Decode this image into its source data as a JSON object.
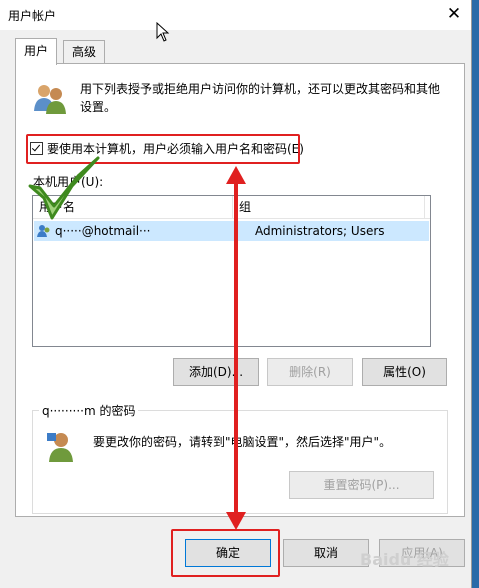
{
  "window": {
    "title": "用户帐户",
    "close_glyph": "✕"
  },
  "tabs": [
    {
      "label": "用户"
    },
    {
      "label": "高级"
    }
  ],
  "panel": {
    "description": "用下列表授予或拒绝用户访问你的计算机，还可以更改其密码和其他设置。",
    "require_login_label": "要使用本计算机，用户必须输入用户名和密码(E)",
    "local_users_label": "本机用户(U):",
    "columns": [
      "用户名",
      "组"
    ],
    "rows": [
      {
        "user": "q·····@hotmail···",
        "group": "Administrators; Users"
      }
    ],
    "buttons": {
      "add": "添加(D)...",
      "remove": "删除(R)",
      "properties": "属性(O)"
    },
    "password_group": {
      "title": "q·········m 的密码",
      "hint": "要更改你的密码，请转到\"电脑设置\"，然后选择\"用户\"。",
      "reset_button": "重置密码(P)..."
    }
  },
  "footer": {
    "ok": "确定",
    "cancel": "取消",
    "apply": "应用(A)"
  },
  "watermark": "Baidu 经验",
  "colors": {
    "annotation": "#e02020",
    "selection": "#cce8ff",
    "checkmark": "#5aa02c"
  }
}
